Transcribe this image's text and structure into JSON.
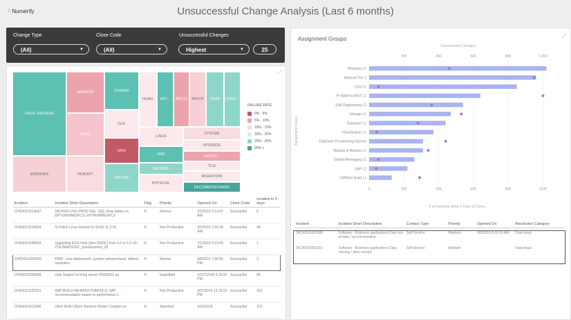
{
  "header": {
    "logo": "Numerify",
    "title": "Unsuccessful Change Analysis (Last 6 months)"
  },
  "filters": {
    "change_type": {
      "label": "Change Type",
      "value": "(All)"
    },
    "close_code": {
      "label": "Close Code",
      "value": "(All)"
    },
    "unsuccessful": {
      "label": "Unsuccessful Changes",
      "value": "Highest"
    },
    "count": "25"
  },
  "treemap": {
    "cells": [
      {
        "label": "LINUX SERVERS",
        "color": "#5cc1b2"
      },
      {
        "label": "WINDOWS",
        "color": "#f6d0d4"
      },
      {
        "label": "SERVERS",
        "color": "#eba4ae"
      },
      {
        "label": "SDDC",
        "color": "#f4c4ca"
      },
      {
        "label": "REBOOT",
        "color": "#f8dde0"
      },
      {
        "label": "CHANGE",
        "color": "#5cc1b2"
      },
      {
        "label": "DUX",
        "color": "#fbe9eb"
      },
      {
        "label": "UNIX",
        "color": "#c05a65"
      },
      {
        "label": "VIRTUAL",
        "color": "#8fd6ca"
      },
      {
        "label": "HUNG",
        "color": "#fbe9eb"
      },
      {
        "label": "INIT...",
        "color": "#5cc1b2"
      },
      {
        "label": "PATCH",
        "color": "#eba4ae"
      },
      {
        "label": "PATCH",
        "color": "#f6d0d4"
      },
      {
        "label": "JTASP",
        "color": "#8fd6ca"
      },
      {
        "label": "UPDA...",
        "color": "#8fd6ca"
      },
      {
        "label": "LINUX",
        "color": "#fbe9eb"
      },
      {
        "label": "DNS",
        "color": "#5cc1b2"
      },
      {
        "label": "RECORD",
        "color": "#8fd6ca"
      },
      {
        "label": "PHYSICAL",
        "color": "#fbe9eb"
      },
      {
        "label": "SYSTEM",
        "color": "#f8dde0"
      },
      {
        "label": "UPGRADE",
        "color": "#fbe9eb"
      },
      {
        "label": "INSTALL",
        "color": "#eba4ae"
      },
      {
        "label": "TILE",
        "color": "#fbe9eb"
      },
      {
        "label": "MIGRATION",
        "color": "#fbe9eb"
      },
      {
        "label": "DECOMMISSIONING",
        "color": "#46a596"
      }
    ],
    "legend_title": "FAILURE RATE",
    "legend": [
      {
        "label": "0% - 5%",
        "color": "#c05a65"
      },
      {
        "label": "5% - 10%",
        "color": "#eba4ae"
      },
      {
        "label": "10% - 15%",
        "color": "#f8dde0"
      },
      {
        "label": "15% - 20%",
        "color": "#d6f1ec"
      },
      {
        "label": "20% - 25%",
        "color": "#8fd6ca"
      },
      {
        "label": "25% +",
        "color": "#46a596"
      }
    ]
  },
  "left_table": {
    "headers": [
      "Incident",
      "Incident Short Description",
      "Flag",
      "Priority",
      "Opened On",
      "Close Code",
      "Incident in 5 days"
    ],
    "rows": [
      [
        "CHG0010213647",
        "DB-RUN-CHG-PROD-SQL: SQL Drop tables on DPYUWV8MSPC21-DPYRVBMESPC2",
        "N",
        "Normal",
        "2/2/2016 3:14:37 AM",
        "Successful",
        "5"
      ],
      [
        "CHG0010218534",
        "To Patch Linux Servers to SLES 11.2.03",
        "N",
        "Non-Production",
        "3/3/2016 2:54:39 AM",
        "Successful",
        "44"
      ],
      [
        "CHG0010244553",
        "Upgrading ESXi Host (Non-SDDC) from 5.0 to 5.5 U3 - ITSUSMPDSDC_Development_03",
        "N",
        "Non-Production",
        "7/1/2016 2:10:43 AM",
        "Successful",
        "1"
      ],
      [
        "CHG0010253559",
        "PDW - new deployment, system enhancement, defects resolution",
        "N",
        "Normal",
        "9/8/2016 7:50:56 PM",
        "Successful",
        "2"
      ],
      [
        "CHG0010269358",
        "Unix Support to bring server IHS08012 up",
        "N",
        "Expedited",
        "10/27/2016 5:19:30 PM",
        "Successful",
        "80"
      ],
      [
        "CHG0010222021",
        "SAP-BUILD-NA-BACKTOBASICS: SAP recommendation based on performance t...",
        "N",
        "Non-Production",
        "3/21/2016 12:19:25 PM",
        "Successful",
        "201"
      ],
      [
        "CHG0010212985",
        "UNIX RUN LINUX Remove Printer Creation on",
        "N",
        "Standard",
        "2/23/2016",
        "Successful",
        "101"
      ]
    ]
  },
  "bar_panel_title": "Assignment Groups",
  "chart_data": {
    "type": "bar",
    "orientation": "horizontal",
    "categories": [
      "Windows L1",
      "Network Tier 2",
      "Unix L1",
      "IP Address MGT L1",
      "SAP Engineering L3",
      "Storage L1",
      "Database L1",
      "Virtualization L1",
      "Database Provisioning-Factory",
      "Backup & Restore L1",
      "Global Messaging L1",
      "SAP L2",
      "VMWare Build L1"
    ],
    "series": [
      {
        "values": [
          102000,
          96000,
          85000,
          64000,
          54000,
          47000,
          44000,
          37000,
          31000,
          31000,
          26000,
          22000,
          13000
        ]
      },
      {
        "axis": "top",
        "values": [
          460,
          950,
          54,
          1000,
          360,
          530,
          280,
          44,
          440,
          340,
          53,
          41,
          290
        ]
      }
    ],
    "bottom_ticks": [
      "0",
      "20K",
      "40K",
      "60K",
      "80K",
      "100K"
    ],
    "top_ticks": [
      "200",
      "400",
      "600",
      "800",
      "1,000"
    ],
    "xlim": [
      0,
      105000
    ],
    "top_xlim": [
      0,
      1050
    ],
    "top_label": "Unsuccessful Changes",
    "xlabel": "# of Incidents within 5 Days of Close...",
    "ylabel": "Assignment Group",
    "colors": {
      "bar": "#a9b4ef",
      "dot": "#9c7cc8"
    }
  },
  "right_table": {
    "headers": [
      "Incident",
      "Incident Short Description",
      "Contact Type",
      "Priority",
      "Opened On",
      "Resolution Category"
    ],
    "rows": [
      [
        "INC00015691090",
        "Software - Business applications Data out-of-date / synchronization",
        "Self-Service",
        "Medium",
        "9/9/2016 8:30:19 AM",
        "Data Issue"
      ],
      [
        "INC00015692110",
        "Software - Business applications Data missing / data corrupt",
        "Self-Service",
        "Medium",
        "",
        "Data Issue"
      ]
    ]
  }
}
